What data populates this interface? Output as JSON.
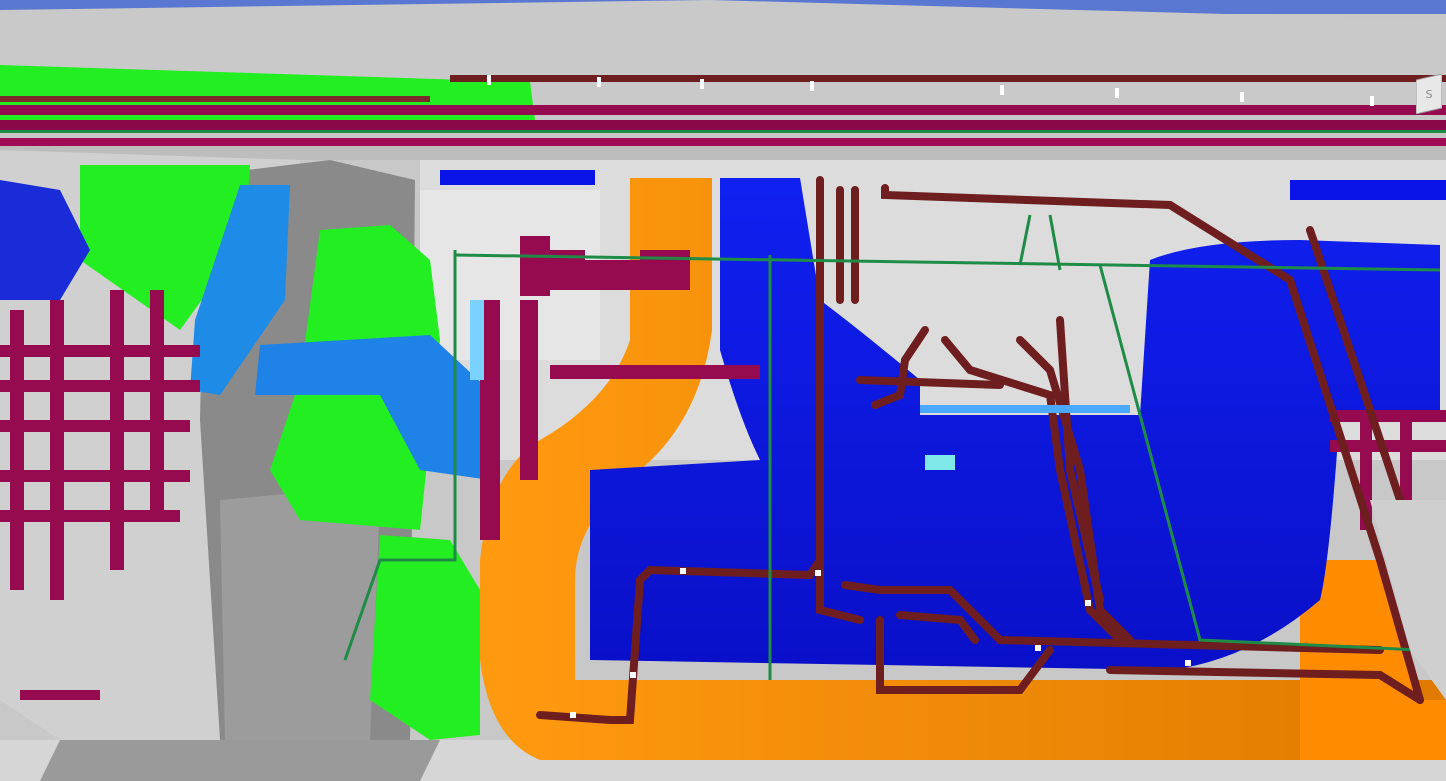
{
  "viewport": {
    "kind": "3d-mep-model-view",
    "palette": {
      "background_structure": "#d2d2d2",
      "structure_dark": "#7a7a7a",
      "supply_duct": "#0a14e6",
      "supply_duct_light": "#1e78e6",
      "return_duct_orange": "#ff8c00",
      "exhaust_duct_green": "#22ee22",
      "pipe_magenta": "#960a50",
      "pipe_brown": "#6e1e1e",
      "conduit_green": "#1e8c46",
      "sky": "#5a78d2"
    }
  }
}
